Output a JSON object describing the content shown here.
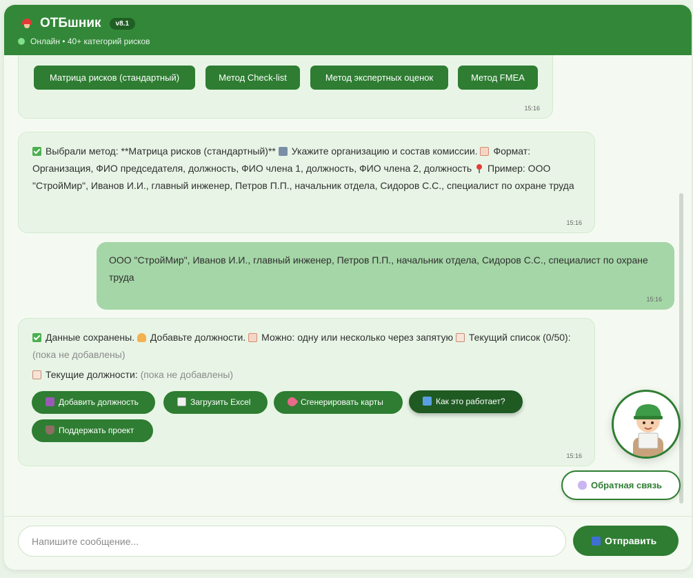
{
  "header": {
    "title": "ОТБшник",
    "version": "v8.1",
    "status": "Онлайн • 40+ категорий рисков"
  },
  "messages": {
    "methods": {
      "buttons": [
        "Матрица рисков (стандартный)",
        "Метод Check-list",
        "Метод экспертных оценок",
        "Метод FMEA"
      ],
      "time": "15:16"
    },
    "bot1": {
      "t1": "Выбрали метод: **Матрица рисков (стандартный)**",
      "t2": "Укажите организацию и состав комиссии.",
      "t3": "Формат: Организация, ФИО председателя, должность, ФИО члена 1, должность, ФИО члена 2, должность",
      "t4": "Пример: ООО \"СтройМир\", Иванов И.И., главный инженер, Петров П.П., начальник отдела, Сидоров С.С., специалист по охране труда",
      "time": "15:16"
    },
    "user1": {
      "text": "ООО \"СтройМир\", Иванов И.И., главный инженер, Петров П.П., начальник отдела, Сидоров С.С., специалист по охране труда",
      "time": "15:16"
    },
    "bot2": {
      "t1": "Данные сохранены.",
      "t2": "Добавьте должности.",
      "t3": "Можно: одну или несколько через запятую",
      "t4": "Текущий список (0/50):",
      "empty1": "(пока не добавлены)",
      "current_label": "Текущие должности:",
      "empty2": "(пока не добавлены)",
      "actions": [
        "Добавить должность",
        "Загрузить Excel",
        "Сгенерировать карты",
        "Как это работает?",
        "Поддержать проект"
      ],
      "time": "15:16"
    }
  },
  "feedback_label": "Обратная связь",
  "composer": {
    "placeholder": "Напишите сообщение...",
    "send_label": "Отправить"
  },
  "colors": {
    "header": "#328838",
    "primary": "#2e7d32",
    "bot_bubble": "#e8f5e6",
    "user_bubble": "#a5d6a7"
  },
  "icons": [
    "helmet-icon",
    "online-dot-icon",
    "check-icon",
    "building-icon",
    "memo-icon",
    "pin-icon",
    "worker-icon",
    "clipboard-icon",
    "plus-icon",
    "chart-icon",
    "rocket-icon",
    "book-icon",
    "cup-icon",
    "speech-icon",
    "send-icon"
  ]
}
